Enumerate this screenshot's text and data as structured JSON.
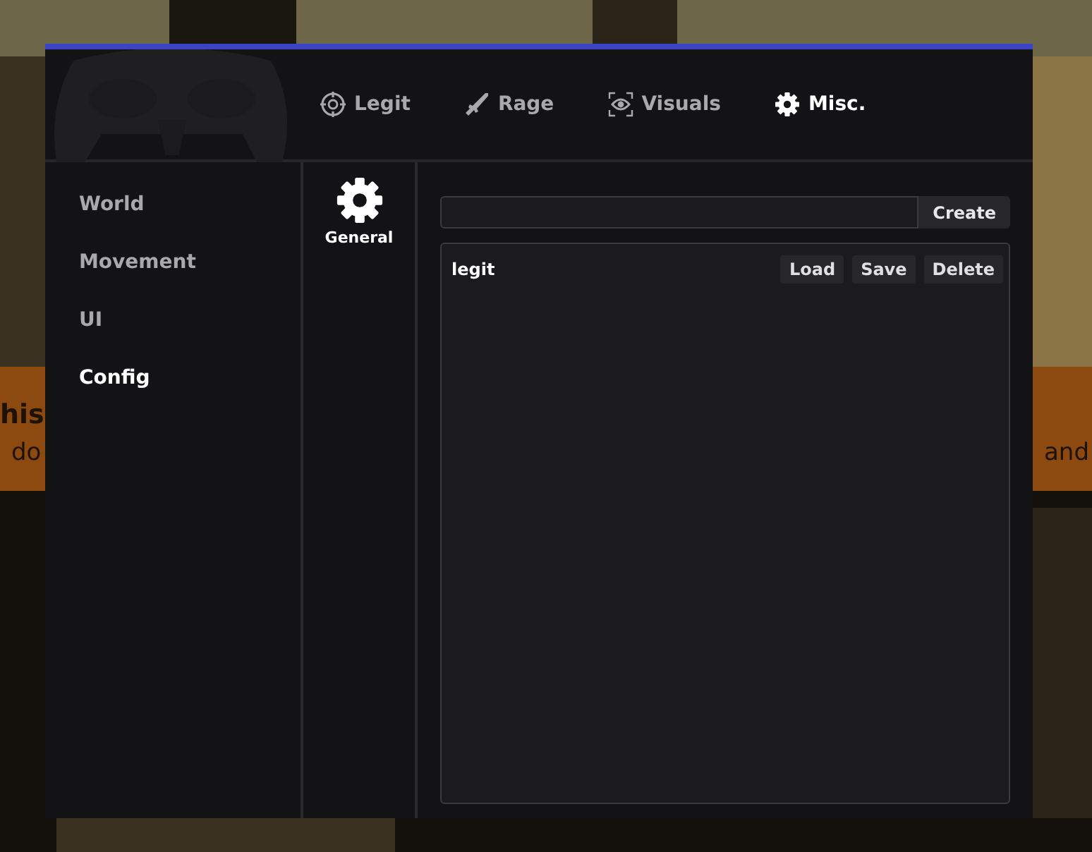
{
  "background": {
    "kind": "picture",
    "banner_heading": "his",
    "banner_text_left": "do",
    "banner_text_right": "and"
  },
  "tabs": [
    {
      "label": "Legit",
      "selected": false
    },
    {
      "label": "Rage",
      "selected": false
    },
    {
      "label": "Visuals",
      "selected": false
    },
    {
      "label": "Misc.",
      "selected": true
    }
  ],
  "sidebar": {
    "items": [
      {
        "label": "World",
        "selected": false
      },
      {
        "label": "Movement",
        "selected": false
      },
      {
        "label": "UI",
        "selected": false
      },
      {
        "label": "Config",
        "selected": true
      }
    ]
  },
  "subtabs": [
    {
      "label": "General",
      "selected": true
    }
  ],
  "config": {
    "create_button": "Create",
    "entries": [
      {
        "name": "legit",
        "buttons": [
          "Load",
          "Save",
          "Delete"
        ]
      }
    ]
  }
}
